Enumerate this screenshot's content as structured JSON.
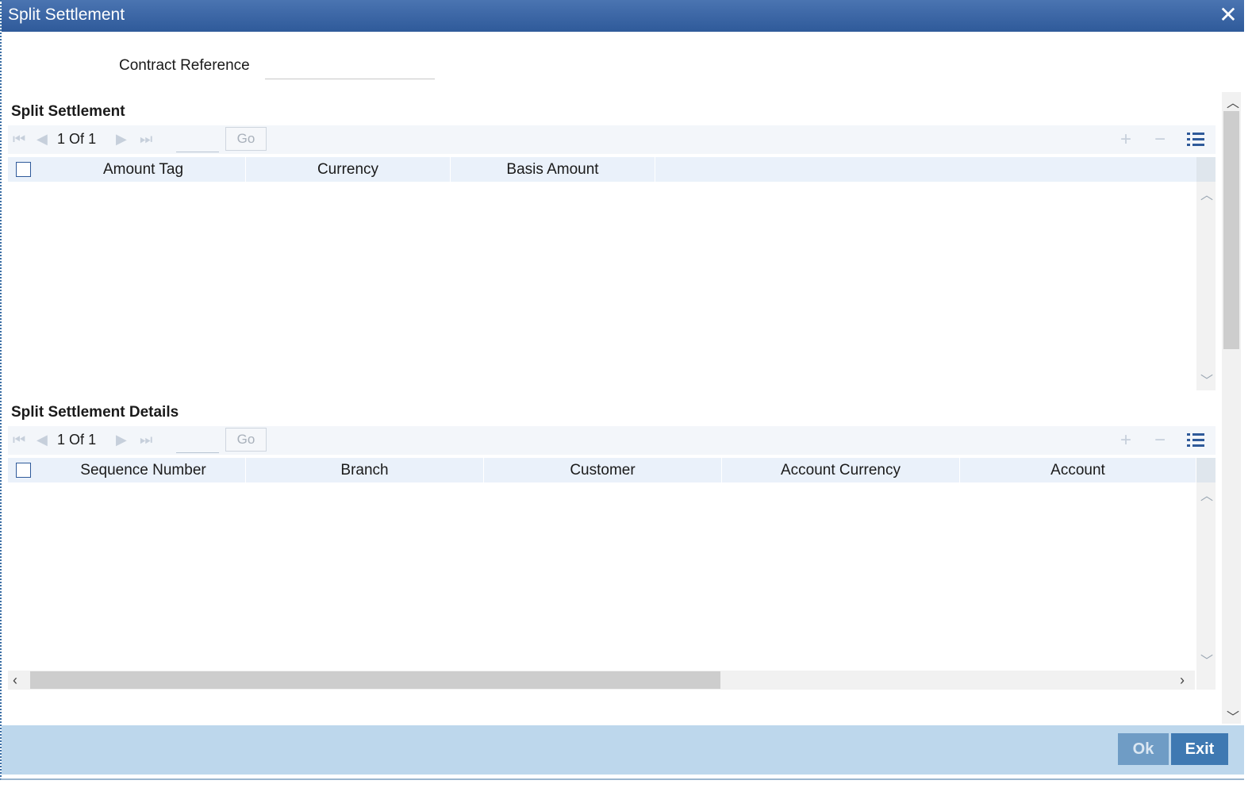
{
  "window": {
    "title": "Split Settlement"
  },
  "form": {
    "contract_reference_label": "Contract Reference",
    "contract_reference_value": ""
  },
  "split_settlement": {
    "title": "Split Settlement",
    "pager": {
      "current": "1",
      "of_label": "Of",
      "total": "1",
      "go_label": "Go"
    },
    "columns": [
      "Amount Tag",
      "Currency",
      "Basis Amount"
    ],
    "rows": []
  },
  "split_settlement_details": {
    "title": "Split Settlement Details",
    "pager": {
      "current": "1",
      "of_label": "Of",
      "total": "1",
      "go_label": "Go"
    },
    "columns": [
      "Sequence Number",
      "Branch",
      "Customer",
      "Account Currency",
      "Account"
    ],
    "rows": []
  },
  "footer": {
    "ok_label": "Ok",
    "exit_label": "Exit"
  },
  "colors": {
    "titlebar": "#2f5a9a",
    "footer": "#bdd7ec",
    "exit_button": "#3f79b2",
    "ok_button_disabled": "#6f9cc5"
  }
}
